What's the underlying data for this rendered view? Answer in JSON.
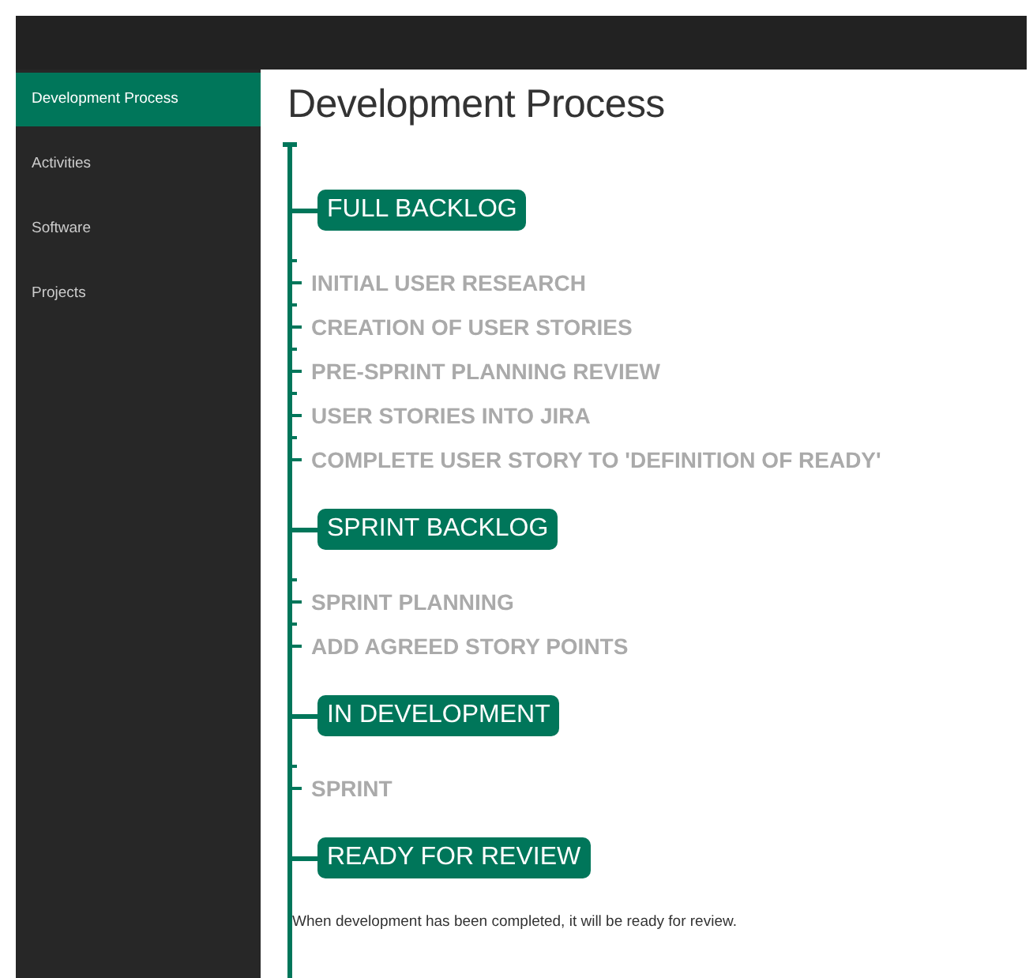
{
  "sidebar": {
    "items": [
      {
        "label": "Development Process",
        "selected": true
      },
      {
        "label": "Activities",
        "selected": false
      },
      {
        "label": "Software",
        "selected": false
      },
      {
        "label": "Projects",
        "selected": false
      }
    ]
  },
  "page": {
    "title": "Development Process"
  },
  "timeline": [
    {
      "label": "FULL BACKLOG",
      "items": [
        "INITIAL USER RESEARCH",
        "CREATION OF USER STORIES",
        "PRE-SPRINT PLANNING REVIEW",
        "USER STORIES INTO JIRA",
        "COMPLETE USER STORY TO 'DEFINITION OF READY'"
      ]
    },
    {
      "label": "SPRINT BACKLOG",
      "items": [
        "SPRINT PLANNING",
        "ADD AGREED STORY POINTS"
      ]
    },
    {
      "label": "IN DEVELOPMENT",
      "items": [
        "SPRINT"
      ]
    },
    {
      "label": "READY FOR REVIEW",
      "description": "When development has been completed, it will be ready for review."
    }
  ]
}
